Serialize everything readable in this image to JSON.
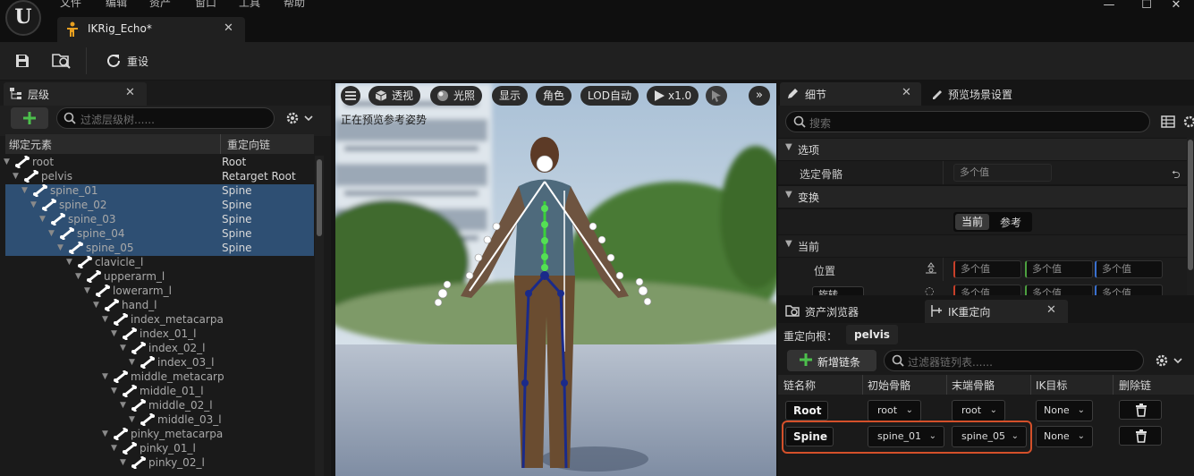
{
  "menu": [
    "文件",
    "编辑",
    "资产",
    "窗口",
    "工具",
    "帮助"
  ],
  "document_tab": {
    "title": "IKRig_Echo*"
  },
  "toolbar": {
    "reset_label": "重设"
  },
  "hierarchy": {
    "tab_label": "层级",
    "search_placeholder": "过滤层级树......",
    "col_bone": "绑定元素",
    "col_chain": "重定向链",
    "rows": [
      {
        "name": "root",
        "chain": "Root",
        "depth": 0,
        "selected": false
      },
      {
        "name": "pelvis",
        "chain": "Retarget Root",
        "depth": 1,
        "selected": false
      },
      {
        "name": "spine_01",
        "chain": "Spine",
        "depth": 2,
        "selected": true
      },
      {
        "name": "spine_02",
        "chain": "Spine",
        "depth": 3,
        "selected": true
      },
      {
        "name": "spine_03",
        "chain": "Spine",
        "depth": 4,
        "selected": true
      },
      {
        "name": "spine_04",
        "chain": "Spine",
        "depth": 5,
        "selected": true
      },
      {
        "name": "spine_05",
        "chain": "Spine",
        "depth": 6,
        "selected": true
      },
      {
        "name": "clavicle_l",
        "chain": "",
        "depth": 7,
        "selected": false
      },
      {
        "name": "upperarm_l",
        "chain": "",
        "depth": 8,
        "selected": false
      },
      {
        "name": "lowerarm_l",
        "chain": "",
        "depth": 9,
        "selected": false
      },
      {
        "name": "hand_l",
        "chain": "",
        "depth": 10,
        "selected": false
      },
      {
        "name": "index_metacarpa",
        "chain": "",
        "depth": 11,
        "selected": false
      },
      {
        "name": "index_01_l",
        "chain": "",
        "depth": 12,
        "selected": false
      },
      {
        "name": "index_02_l",
        "chain": "",
        "depth": 13,
        "selected": false
      },
      {
        "name": "index_03_l",
        "chain": "",
        "depth": 14,
        "selected": false
      },
      {
        "name": "middle_metacarp",
        "chain": "",
        "depth": 11,
        "selected": false
      },
      {
        "name": "middle_01_l",
        "chain": "",
        "depth": 12,
        "selected": false
      },
      {
        "name": "middle_02_l",
        "chain": "",
        "depth": 13,
        "selected": false
      },
      {
        "name": "middle_03_l",
        "chain": "",
        "depth": 14,
        "selected": false
      },
      {
        "name": "pinky_metacarpa",
        "chain": "",
        "depth": 11,
        "selected": false
      },
      {
        "name": "pinky_01_l",
        "chain": "",
        "depth": 12,
        "selected": false
      },
      {
        "name": "pinky_02_l",
        "chain": "",
        "depth": 13,
        "selected": false
      }
    ]
  },
  "viewport": {
    "buttons": {
      "perspective": "透视",
      "lighting": "光照",
      "show": "显示",
      "character": "角色",
      "lod": "LOD自动",
      "speed": "x1.0"
    },
    "overlay_text": "正在预览参考姿势"
  },
  "details": {
    "tab_details": "细节",
    "tab_preview_settings": "预览场景设置",
    "search_placeholder": "搜索",
    "section_selection": "选项",
    "selected_bones_label": "选定骨骼",
    "selected_bones_value": "多个值",
    "section_transform": "变换",
    "toggle_current": "当前",
    "toggle_reference": "参考",
    "section_current": "当前",
    "position_label": "位置",
    "position_x": "多个值",
    "position_y": "多个值",
    "position_z": "多个值",
    "rotation_label": "旋转",
    "rotation_values": [
      "多个值",
      "多个值",
      "多个值"
    ]
  },
  "ik_retarget": {
    "tab_asset_browser": "资产浏览器",
    "tab_ik_retarget": "IK重定向",
    "root_label": "重定向根：",
    "root_value": "pelvis",
    "add_chain_label": "新增链条",
    "search_placeholder": "过滤器链列表......",
    "columns": {
      "name": "链名称",
      "start": "初始骨骼",
      "end": "末端骨骼",
      "goal": "IK目标",
      "delete": "删除链"
    },
    "chains": [
      {
        "name": "Root",
        "start": "root",
        "end": "root",
        "goal": "None"
      },
      {
        "name": "Spine",
        "start": "spine_01",
        "end": "spine_05",
        "goal": "None"
      }
    ]
  },
  "colors": {
    "accent": "#2e4f73",
    "highlight_border": "#d4502a",
    "add_green": "#4cc04c"
  },
  "icons": [
    "save-icon",
    "browse-icon",
    "reset-icon",
    "bone-icon",
    "gear-icon",
    "search-icon",
    "close-icon",
    "trash-icon",
    "plus-icon",
    "hamburger-icon",
    "cube-icon",
    "sphere-icon",
    "play-icon",
    "chevron-right-icon",
    "paint-icon",
    "grid-icon"
  ]
}
